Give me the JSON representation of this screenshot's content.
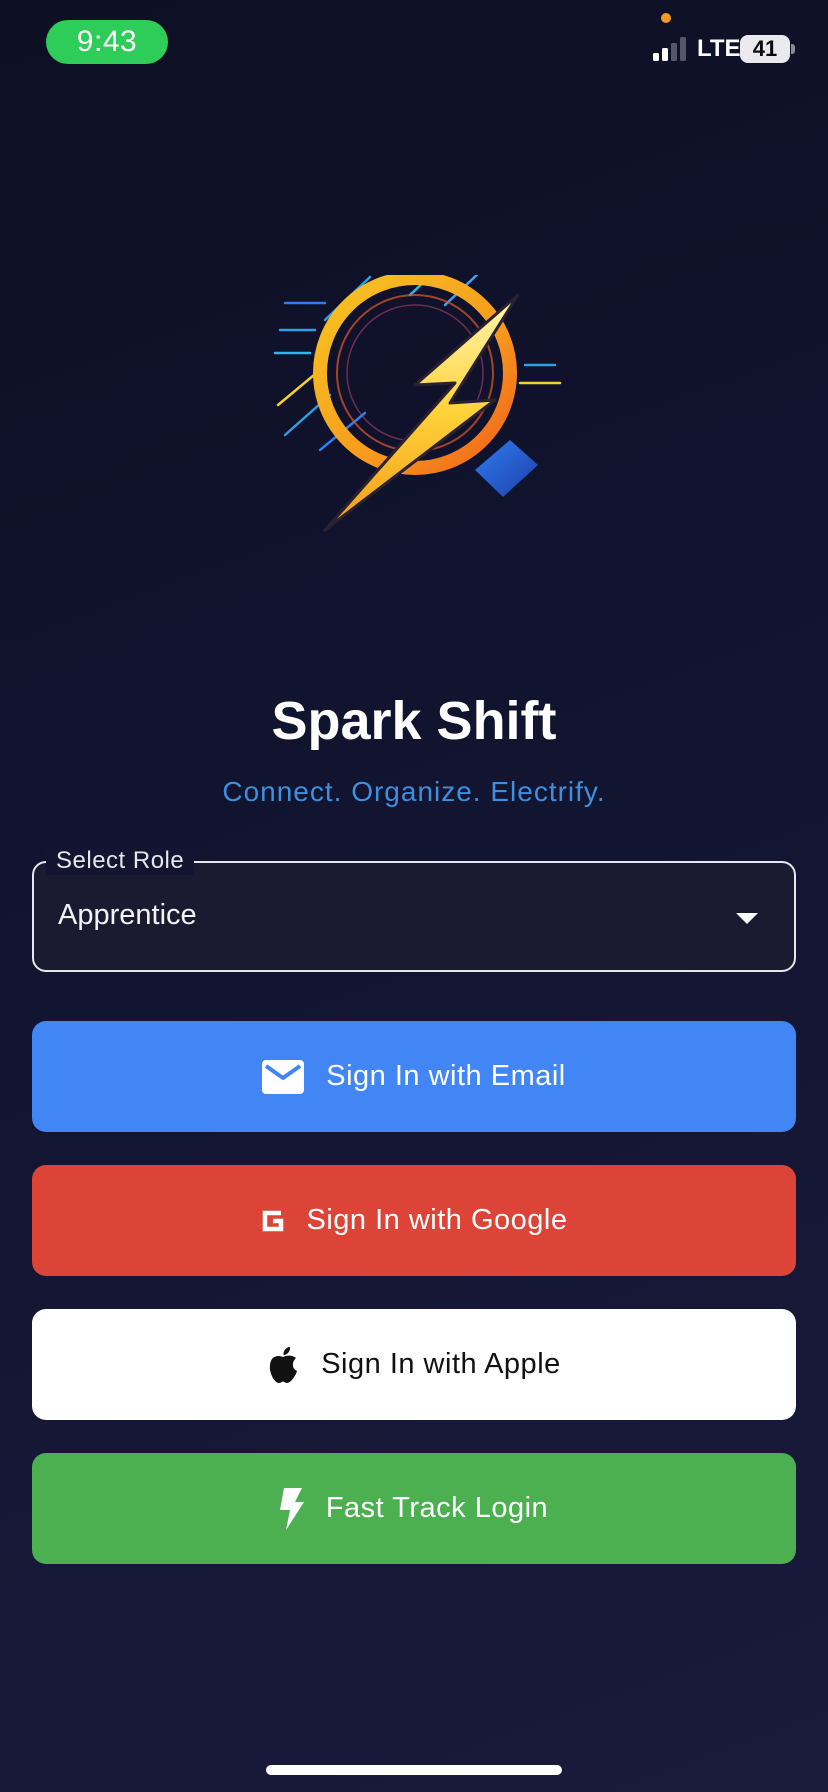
{
  "status_bar": {
    "time": "9:43",
    "network": "LTE",
    "battery": "41",
    "icons": [
      "signal-icon",
      "battery-icon"
    ]
  },
  "app": {
    "title": "Spark Shift",
    "tagline": "Connect. Organize. Electrify.",
    "logo_icon": "lightning-bolt-logo"
  },
  "role_select": {
    "label": "Select Role",
    "value": "Apprentice",
    "icon": "dropdown-caret-icon"
  },
  "buttons": {
    "email": {
      "label": "Sign In with Email",
      "icon": "mail-icon",
      "color": "#4285f4"
    },
    "google": {
      "label": "Sign In with Google",
      "icon": "google-icon",
      "color": "#db4437"
    },
    "apple": {
      "label": "Sign In with Apple",
      "icon": "apple-icon",
      "color": "#ffffff"
    },
    "fast_track": {
      "label": "Fast Track Login",
      "icon": "flash-icon",
      "color": "#4caf50"
    }
  },
  "theme": {
    "background": "#121531",
    "accent": "#3d8fe0"
  }
}
